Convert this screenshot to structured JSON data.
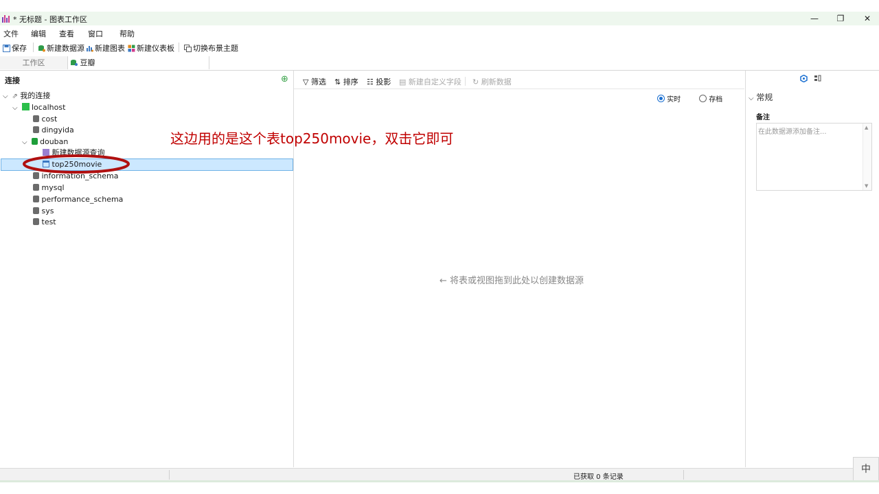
{
  "window": {
    "title": "* 无标题 - 图表工作区",
    "minimize": "—",
    "restore": "❐",
    "close": "✕"
  },
  "menu": [
    "文件",
    "编辑",
    "查看",
    "窗口",
    "帮助"
  ],
  "toolbar": {
    "save": "保存",
    "new_datasource": "新建数据源",
    "new_chart": "新建图表",
    "new_dashboard": "新建仪表板",
    "switch_theme": "切换布景主题"
  },
  "tabs": [
    "工作区",
    "豆瓣"
  ],
  "left_panel": {
    "title": "连接",
    "add_icon": "⊕",
    "tree": {
      "root": "我的连接",
      "host": "localhost",
      "dbs_before": [
        "cost",
        "dingyida"
      ],
      "open_db": "douban",
      "new_query": "新建数据源查询",
      "selected_table": "top250movie",
      "dbs_after": [
        "information_schema",
        "mysql",
        "performance_schema",
        "sys",
        "test"
      ]
    }
  },
  "middle_panel": {
    "toolbar": {
      "filter": "筛选",
      "sort": "排序",
      "projection": "投影",
      "new_custom_field": "新建自定义字段",
      "refresh": "刷新数据"
    },
    "mode_realtime": "实时",
    "mode_archive": "存档",
    "hint_arrow": "←",
    "hint": "将表或视图拖到此处以创建数据源"
  },
  "right_panel": {
    "section": "常规",
    "notes_label": "备注",
    "notes_placeholder": "在此数据源添加备注..."
  },
  "annotation": "这边用的是这个表top250movie，双击它即可",
  "status": {
    "records": "已获取 0 条记录",
    "ime": "中"
  },
  "colors": {
    "annotation_red": "#c00000",
    "selection_bg": "#cce8ff",
    "accent_green": "#1e9e3a",
    "accent_blue": "#1a6fd1"
  }
}
